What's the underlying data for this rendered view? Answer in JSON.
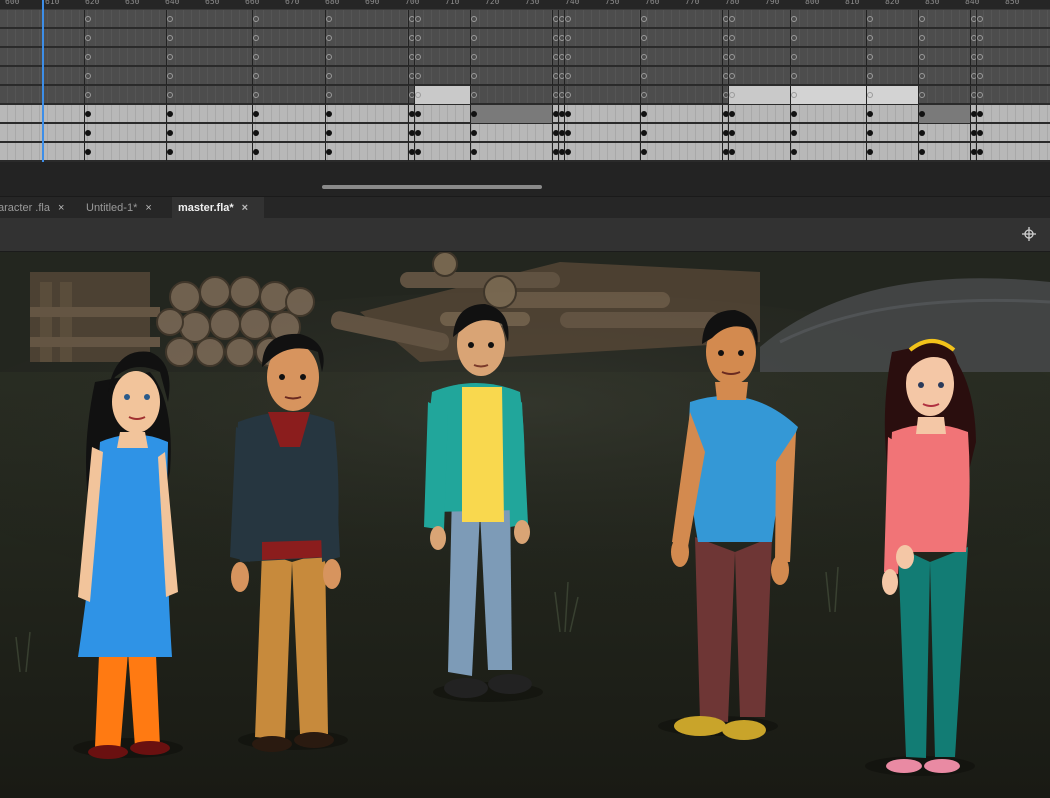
{
  "timeline": {
    "ruler_labels": [
      "600",
      "610",
      "620",
      "630",
      "640",
      "650",
      "660",
      "670",
      "680",
      "690",
      "700",
      "710",
      "720",
      "730",
      "740",
      "750",
      "760",
      "770",
      "780",
      "790",
      "800",
      "810",
      "820",
      "830",
      "840",
      "850"
    ]
  },
  "tabs": [
    {
      "label": "aracter .fla",
      "close": "×",
      "active": false
    },
    {
      "label": "Untitled-1*",
      "close": "×",
      "active": false
    },
    {
      "label": "master.fla*",
      "close": "×",
      "active": true
    }
  ],
  "toolbar": {
    "center_stage_icon": "crosshair-icon"
  },
  "stage": {
    "scene": "campfire woodpile background",
    "characters": [
      {
        "name": "woman-blue-kurta",
        "top": "#2f93e6",
        "bottom": "#ff7a12"
      },
      {
        "name": "man-dark-jacket",
        "top": "#263640",
        "bottom": "#c78a3c"
      },
      {
        "name": "boy-teal-hoodie",
        "top": "#21a69b",
        "bottom": "#7d9bb7"
      },
      {
        "name": "man-blue-tshirt",
        "top": "#3498d6",
        "bottom": "#6e3635"
      },
      {
        "name": "woman-pink-shirt",
        "top": "#f17477",
        "bottom": "#127c74"
      }
    ]
  }
}
